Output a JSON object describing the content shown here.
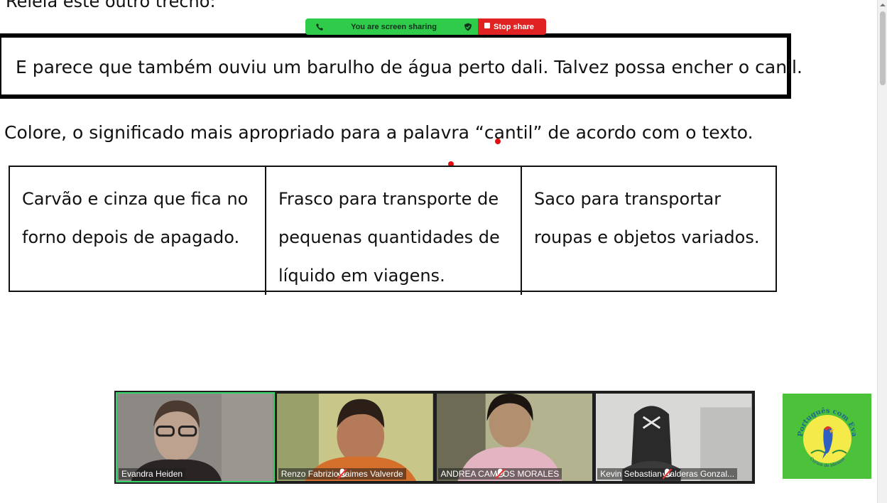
{
  "document": {
    "heading": "Releia este outro trecho:",
    "quote": "E parece que também ouviu um barulho de água perto dali. Talvez possa encher o canil.",
    "question": "Colore, o significado mais apropriado para a palavra “cantil” de acordo com o texto.",
    "options": [
      {
        "line1": "Carvão e cinza que fica no",
        "line2": "forno depois de apagado.",
        "line3": ""
      },
      {
        "line1": "Frasco para transporte de",
        "line2": "pequenas quantidades de",
        "line3": "líquido em viagens."
      },
      {
        "line1": "Saco para transportar",
        "line2": "roupas e objetos variados.",
        "line3": ""
      }
    ]
  },
  "share_bar": {
    "status_label": "You are screen sharing",
    "stop_label": "Stop share",
    "status_color": "#2ecc4a",
    "stop_color": "#e02222"
  },
  "gallery": {
    "participants": [
      {
        "name": "Evandra Heiden",
        "muted": false,
        "active": true
      },
      {
        "name": "Renzo Fabrizio Jaimes Valverde",
        "muted": true,
        "active": false
      },
      {
        "name": "ANDREA CAMPOS MORALES",
        "muted": true,
        "active": false
      },
      {
        "name": "Kevin Sebastian Balderas Gonzal...",
        "muted": true,
        "active": false
      }
    ],
    "active_speaker_color": "#35d46a"
  },
  "logo": {
    "text_top": "Português com Eva",
    "text_bottom": "Cursos de idiomas",
    "background": "#4cc23a"
  }
}
